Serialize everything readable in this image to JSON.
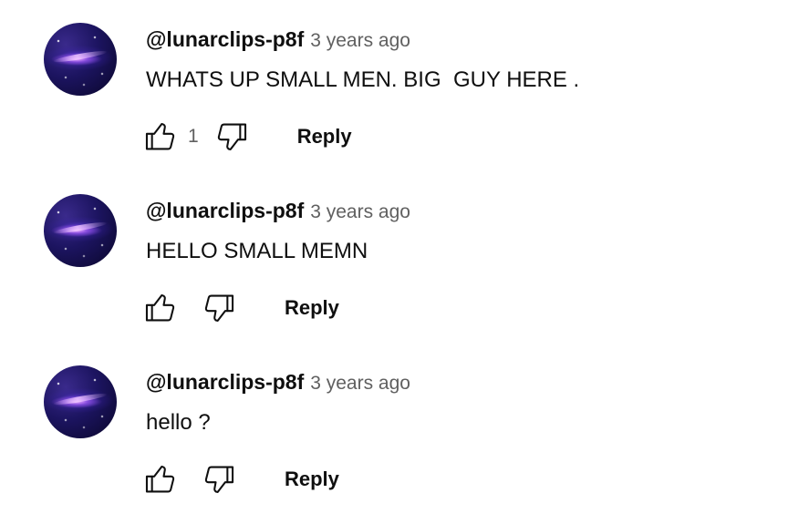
{
  "comments": [
    {
      "author": "@lunarclips-p8f",
      "time": "3 years ago",
      "text": "WHATS UP SMALL MEN. BIG  GUY HERE .",
      "like_count": "1",
      "reply_label": "Reply"
    },
    {
      "author": "@lunarclips-p8f",
      "time": "3 years ago",
      "text": "HELLO SMALL MEMN",
      "like_count": "",
      "reply_label": "Reply"
    },
    {
      "author": "@lunarclips-p8f",
      "time": "3 years ago",
      "text": "hello ?",
      "like_count": "",
      "reply_label": "Reply"
    }
  ],
  "icons": {
    "like": "thumbs-up-icon",
    "dislike": "thumbs-down-icon",
    "avatar": "galaxy-avatar"
  },
  "colors": {
    "primary_text": "#0f0f0f",
    "secondary_text": "#606060",
    "background": "#ffffff"
  }
}
